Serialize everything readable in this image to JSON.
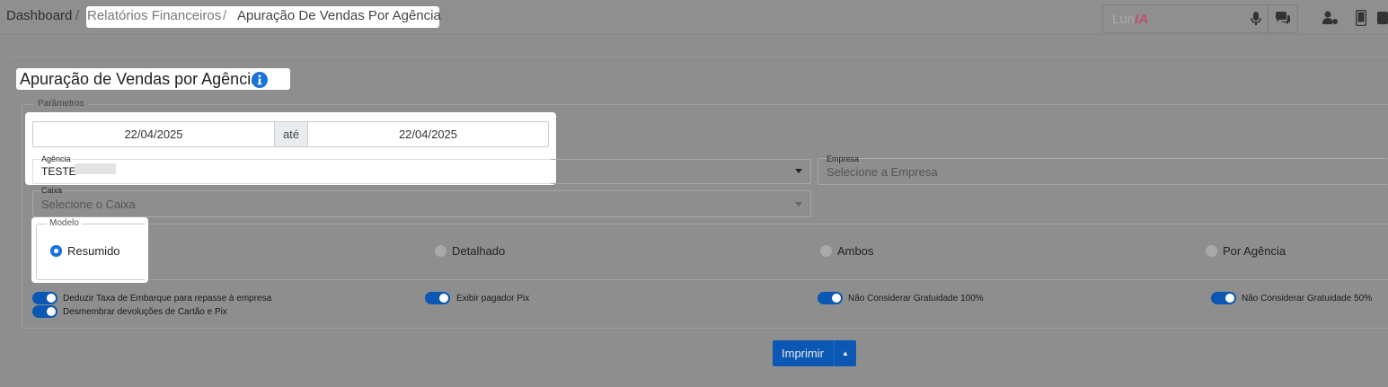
{
  "breadcrumb": {
    "home": "Dashboard",
    "sep": "/",
    "parent": "Relatórios Financeiros",
    "current": "Apuração De Vendas Por Agência"
  },
  "assistant": {
    "name_prefix": "Lun",
    "name_suffix": "IA"
  },
  "page": {
    "title": "Apuração de Vendas por Agência"
  },
  "params": {
    "legend": "Parâmetros",
    "date_from": "22/04/2025",
    "date_sep": "até",
    "date_to": "22/04/2025",
    "agencia": {
      "label": "Agência",
      "value": "TESTE"
    },
    "empresa": {
      "label": "Empresa",
      "placeholder": "Selecione a Empresa"
    },
    "caixa": {
      "label": "Caixa",
      "placeholder": "Selecione o Caixa"
    }
  },
  "modelo": {
    "legend": "Modelo",
    "options": [
      "Resumido",
      "Detalhado",
      "Ambos",
      "Por Agência"
    ],
    "selected": "Resumido"
  },
  "toggles": [
    {
      "label": "Deduzir Taxa de Embarque para repasse à empresa",
      "on": true
    },
    {
      "label": "Desmembrar devoluções de Cartão e Pix",
      "on": true
    },
    {
      "label": "Exibir pagador Pix",
      "on": true
    },
    {
      "label": "Não Considerar Gratuidade 100%",
      "on": true
    },
    {
      "label": "Não Considerar Gratuidade 50%",
      "on": true
    }
  ],
  "actions": {
    "print_label": "Imprimir"
  },
  "colors": {
    "accent": "#0a58b4",
    "radio": "#1a73d9",
    "lunia_ia": "#c0506a"
  }
}
